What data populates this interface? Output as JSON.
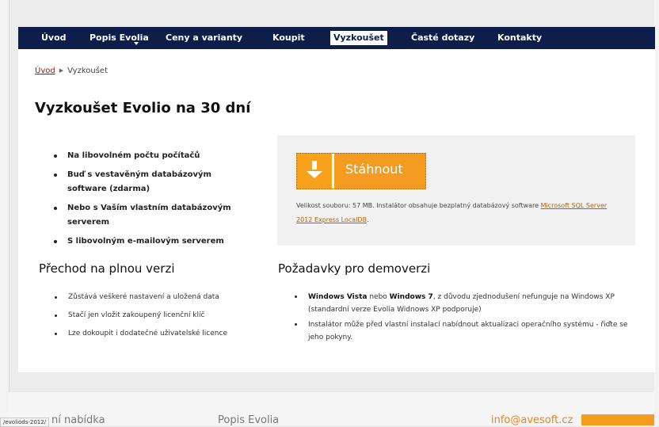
{
  "nav": {
    "items": [
      {
        "label": "Úvod",
        "active": false
      },
      {
        "label": "Popis Evolia",
        "active": false
      },
      {
        "label": "Ceny a varianty",
        "active": false
      },
      {
        "label": "Koupit",
        "active": false
      },
      {
        "label": "Vyzkoušet",
        "active": true
      },
      {
        "label": "Časté dotazy",
        "active": false
      },
      {
        "label": "Kontakty",
        "active": false
      }
    ]
  },
  "breadcrumb": {
    "home": "Úvod",
    "current": "Vyzkoušet"
  },
  "page_title": "Vyzkoušet Evolio na 30 dní",
  "features": [
    "Na libovolném počtu počítačů",
    "Buď s vestavěným databázovým software (zdarma)",
    "Nebo s Vaším vlastním databázovým serverem",
    "S libovolným e-mailovým serverem"
  ],
  "download": {
    "button_label": "Stáhnout",
    "info_text": "Velikost souboru: 57 MB. Instalátor obsahuje bezplatný databázový software ",
    "info_link": "Microsoft SQL Server 2012 Express LocalDB",
    "info_end": "."
  },
  "full_version": {
    "heading": "Přechod na plnou verzi",
    "items": [
      "Zůstává veškeré nastavení a uložená data",
      "Stačí jen vložit zakoupený licenční klíč",
      "Lze dokoupit i dodatečné uživatelské licence"
    ]
  },
  "requirements": {
    "heading": "Požadavky pro demoverzi",
    "item1_b1": "Windows Vista",
    "item1_mid": " nebo ",
    "item1_b2": "Windows 7",
    "item1_rest": ", z důvodu zjednodušení nefunguje na Windows XP (standardní verze Evolia Widnows XP podporuje)",
    "item2": "Instalátor může před vlastní instalací nabídnout aktualizaci operačního systému - řiďte se jeho pokyny."
  },
  "footer": {
    "offer": "ní nabídka",
    "popis": "Popis Evolia",
    "email": "info@avesoft.cz"
  },
  "status_url": "/evoliods-2012/",
  "colors": {
    "nav_bg": "#0d1e4b",
    "accent_orange": "#f39c1f",
    "link_red": "#8b1c15"
  }
}
